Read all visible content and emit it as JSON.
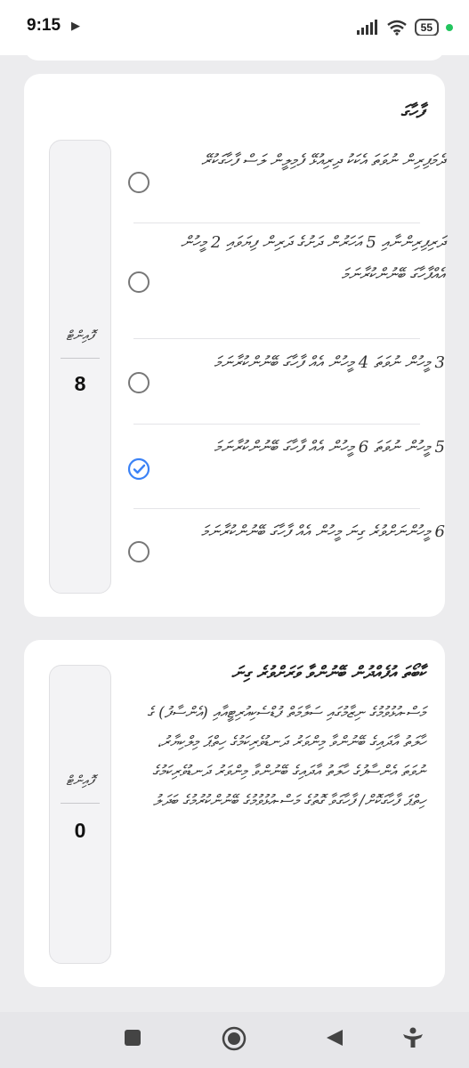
{
  "status_bar": {
    "time": "9:15",
    "media_icon": "play-triangle-icon",
    "battery": "55",
    "icons": [
      "signal-icon",
      "wifi-icon",
      "battery-icon",
      "notification-dot-icon"
    ]
  },
  "question_card": {
    "title": "ފާހާގަ",
    "score": {
      "label": "ފޮއިންޓް",
      "value": "8"
    },
    "options": [
      {
        "text": "ދެމަފިރިން ނުވަތަ އެކަކު ދިރިއުޅޭ ފެމިލީން ލަސް ފާހާގަކުރޭ",
        "selected": false
      },
      {
        "text": "ދަރިފިރިންނާއި 5 އަހަރުން ދަށުގެ ދަރިން ފިޔަވައި 2 މީހުން އެއްފާހާގަ ބޭނުންކުރާނަމަ",
        "selected": false
      },
      {
        "text": "3 މީހުން ނުވަތަ 4 މީހުން އެއް ފާހާގަ ބޭނުންކުރާނަމަ",
        "selected": false
      },
      {
        "text": "5 މީހުން ނުވަތަ 6 މީހުން އެއް ފާހާގަ ބޭނުންކުރާނަމަ",
        "selected": true
      },
      {
        "text": "6 މީހުންނަށްވުރެ ގިނަ މީހުން އެއް ފާހާގަ ބޭނުންކުރާނަމަ",
        "selected": false
      }
    ],
    "colors": {
      "accent": "#3b82f6",
      "radio": "#777777"
    }
  },
  "info_card": {
    "title": "ކާބޯތަ އުފެއްދުން ބޭނުންވާ ވަރަށްވުރެ ގިނަ",
    "body": "މަސް-އުޅުވުމުގެ ނިޒާމުގައި ސަލާމަތް ފުޑްސެކިއުރިޓީއާއި (އެންސާފު) ގެ ހާލަތު އާދައިގެ ބޭނުންވާ މިންވަރު ދަނޑުވެރިކަމުގެ ހިތްޕަ މިލްކިޔާރު، ނުވަތަ އެންސާފުގެ ހާލަތު އާދައިގެ ބޭނުންވާ މިންވަރު ދަނޑުވެރިކަމުގެ ހިތްޕަ ފާހާގަކޮށް/ ފާހާގަވާ ގޮތުގެ މަސް-އުޅުވުމުގެ ބޭނުންކުރުމުގެ ބަދަލު",
    "score": {
      "label": "ފޮއިންޓް",
      "value": "0"
    }
  },
  "nav_bar": {
    "buttons": [
      "stop-square-icon",
      "home-circle-icon",
      "back-triangle-icon",
      "accessibility-person-icon"
    ]
  }
}
